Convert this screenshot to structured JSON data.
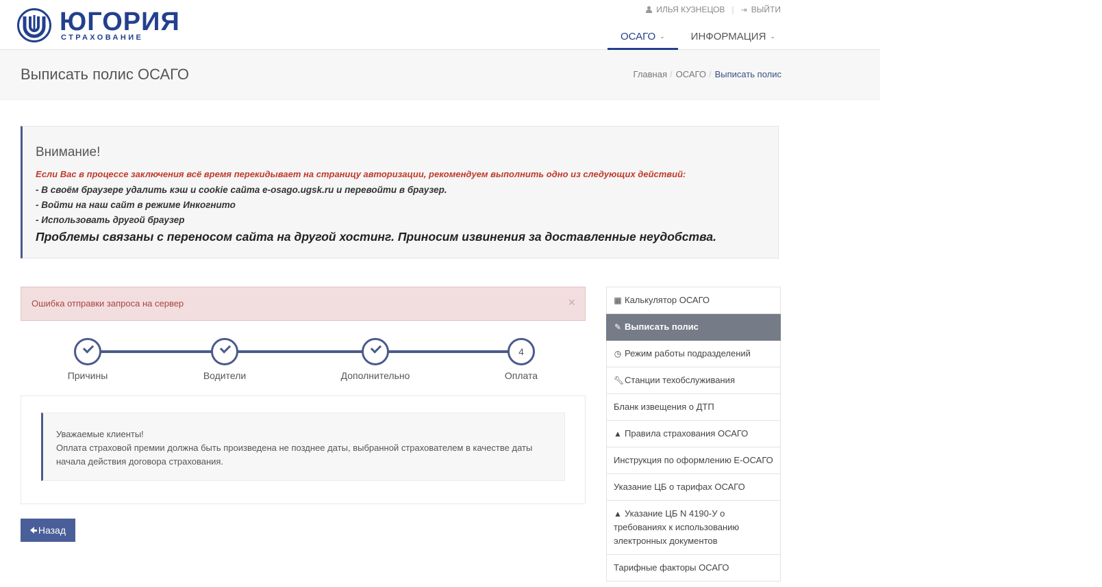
{
  "brand": {
    "name": "ЮГОРИЯ",
    "subtitle": "СТРАХОВАНИЕ",
    "accent": "#23408e"
  },
  "user": {
    "name": "ИЛЬЯ КУЗНЕЦОВ",
    "logout": "ВЫЙТИ"
  },
  "nav": {
    "items": [
      {
        "label": "ОСАГО"
      },
      {
        "label": "ИНФОРМАЦИЯ"
      }
    ]
  },
  "page": {
    "title": "Выписать полис ОСАГО"
  },
  "breadcrumb": {
    "home": "Главная",
    "section": "ОСАГО",
    "current": "Выписать полис"
  },
  "warning": {
    "title": "Внимание!",
    "intro": "Если Вас в процессе заключения всё время перекидывает на страницу авторизации, рекомендуем выполнить одно из следующих действий:",
    "items": [
      "- В своём браузере удалить кэш и cookie сайта e-osago.ugsk.ru и перевойти в браузер.",
      "- Войти на наш сайт в режиме Инкогнито",
      "- Использовать другой браузер"
    ],
    "footer": "Проблемы связаны с переносом сайта на другой хостинг. Приносим извинения за доставленные неудобства."
  },
  "alert": {
    "text": "Ошибка отправки запроса на сервер",
    "close": "×"
  },
  "steps": [
    {
      "label": "Причины",
      "done": true
    },
    {
      "label": "Водители",
      "done": true
    },
    {
      "label": "Дополнительно",
      "done": true
    },
    {
      "label": "Оплата",
      "done": false,
      "number": "4"
    }
  ],
  "notice": {
    "line1": "Уважаемые клиенты!",
    "line2": "Оплата страховой премии должна быть произведена не позднее даты, выбранной страхователем в качестве даты начала действия договора страхования."
  },
  "back_button": {
    "label": "Назад"
  },
  "side_menu": [
    {
      "label": "Калькулятор ОСАГО",
      "icon": "calculator-icon"
    },
    {
      "label": "Выписать полис",
      "icon": "edit-icon"
    },
    {
      "label": "Режим работы подразделений",
      "icon": "clock-icon"
    },
    {
      "label": "Станции техобслуживания",
      "icon": "wrench-icon"
    },
    {
      "label": "Бланк извещения о ДТП",
      "icon": ""
    },
    {
      "label": "Правила страхования ОСАГО",
      "icon": "graduation-cap-icon"
    },
    {
      "label": "Инструкция по оформлению Е-ОСАГО",
      "icon": ""
    },
    {
      "label": "Указание ЦБ о тарифах ОСАГО",
      "icon": ""
    },
    {
      "label": "Указание ЦБ N 4190-У о требованиях к использованию электронных документов",
      "icon": "graduation-cap-icon"
    },
    {
      "label": "Тарифные факторы ОСАГО",
      "icon": ""
    }
  ]
}
